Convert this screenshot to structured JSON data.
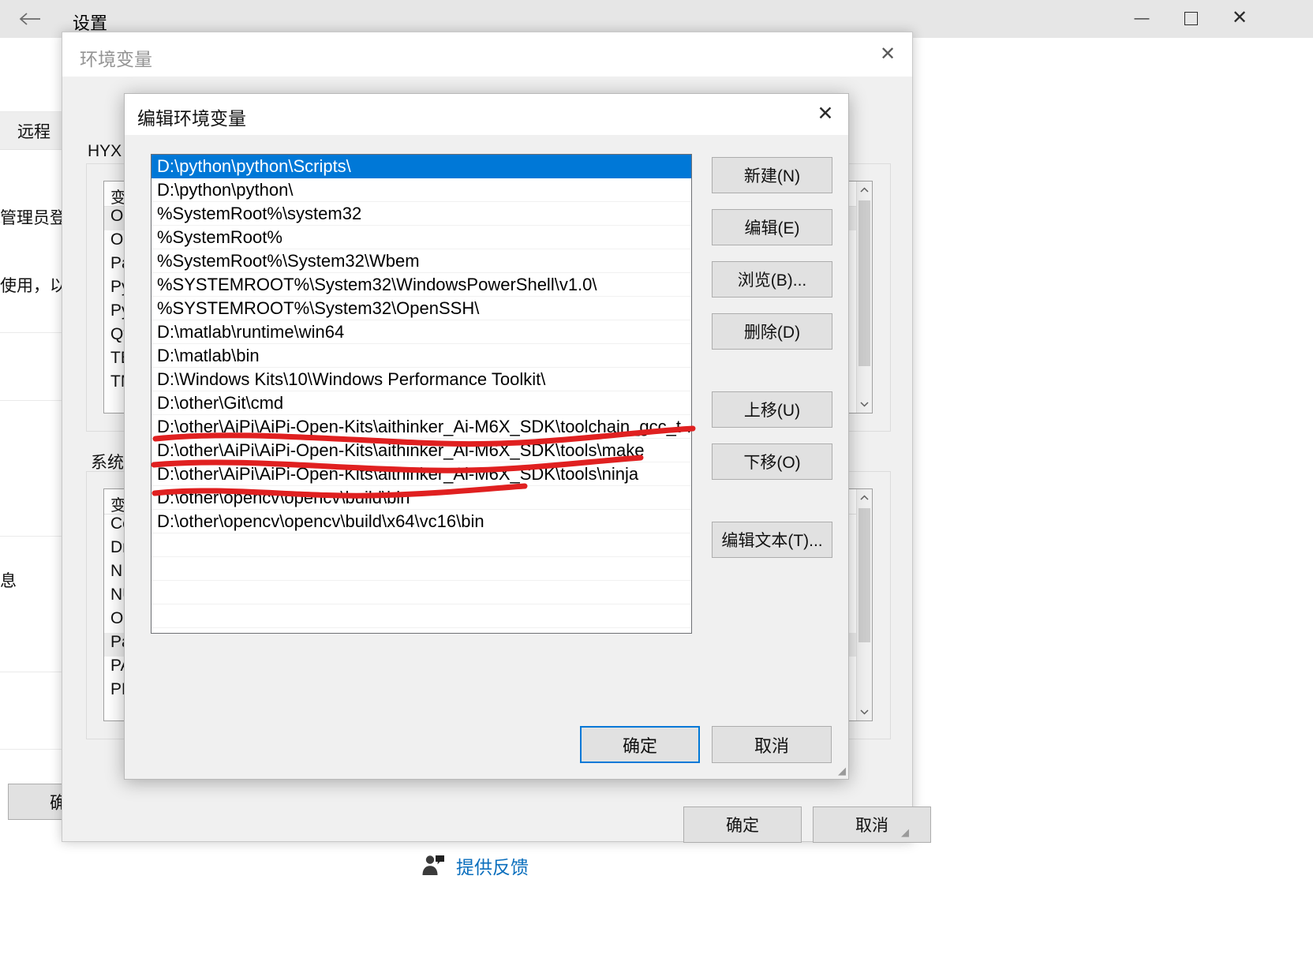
{
  "settings_window": {
    "title": "设置",
    "back_icon": "back-arrow-icon",
    "minimize_label": "—",
    "maximize_label": "□",
    "close_label": "✕",
    "tabs": [
      {
        "label": "远程"
      }
    ],
    "texts": [
      {
        "text": "管理员登录"
      },
      {
        "text": "使用，以及"
      },
      {
        "text": "息"
      }
    ],
    "ok_label": "确定"
  },
  "envvar_dialog": {
    "title": "环境变量",
    "close_label": "✕",
    "user_section_label": "HYX 的用户变量(U)",
    "system_section_label": "系统变量(S)",
    "column_header": "变量",
    "user_variables": [
      "OneDrive",
      "OneDriveConsumer",
      "Path",
      "PyCharm",
      "PyCharmProjects",
      "QtTools",
      "TEMP",
      "TMP"
    ],
    "system_variables": [
      "ComSpec",
      "DriverData",
      "NIEXTCCOMPILERSUPP",
      "NUMBER_OF_PROCESSORS",
      "OS",
      "Path",
      "PATHEXT",
      "PROCESSOR_ARCHITECTURE"
    ],
    "ok_label": "确定",
    "cancel_label": "取消",
    "scroll_up_icon": "chevron-up-icon",
    "scroll_down_icon": "chevron-down-icon"
  },
  "edit_dialog": {
    "title": "编辑环境变量",
    "close_label": "✕",
    "selected_index": 0,
    "paths": [
      "D:\\python\\python\\Scripts\\",
      "D:\\python\\python\\",
      "%SystemRoot%\\system32",
      "%SystemRoot%",
      "%SystemRoot%\\System32\\Wbem",
      "%SYSTEMROOT%\\System32\\WindowsPowerShell\\v1.0\\",
      "%SYSTEMROOT%\\System32\\OpenSSH\\",
      "D:\\matlab\\runtime\\win64",
      "D:\\matlab\\bin",
      "D:\\Windows Kits\\10\\Windows Performance Toolkit\\",
      "D:\\other\\Git\\cmd",
      "D:\\other\\AiPi\\AiPi-Open-Kits\\aithinker_Ai-M6X_SDK\\toolchain_gcc_t-...",
      "D:\\other\\AiPi\\AiPi-Open-Kits\\aithinker_Ai-M6X_SDK\\tools\\make",
      "D:\\other\\AiPi\\AiPi-Open-Kits\\aithinker_Ai-M6X_SDK\\tools\\ninja",
      "D:\\other\\opencv\\opencv\\build\\bin",
      "D:\\other\\opencv\\opencv\\build\\x64\\vc16\\bin"
    ],
    "buttons": {
      "new": "新建(N)",
      "edit": "编辑(E)",
      "browse": "浏览(B)...",
      "delete": "删除(D)",
      "move_up": "上移(U)",
      "move_down": "下移(O)",
      "edit_text": "编辑文本(T)..."
    },
    "ok_label": "确定",
    "cancel_label": "取消"
  },
  "feedback": {
    "icon": "person-feedback-icon",
    "label": "提供反馈"
  },
  "annotations": {
    "color": "#e02020",
    "underlines": [
      {
        "desc": "underline on toolchain_gcc path row"
      },
      {
        "desc": "underline on tools\\make path row"
      },
      {
        "desc": "underline on tools\\ninja path row"
      }
    ]
  },
  "colors": {
    "accent": "#0078d7",
    "selection": "#0078d7",
    "dialog_bg": "#f0f0f0",
    "button_bg": "#e1e1e1",
    "link": "#0a6ebd",
    "annotation_red": "#e02020"
  }
}
